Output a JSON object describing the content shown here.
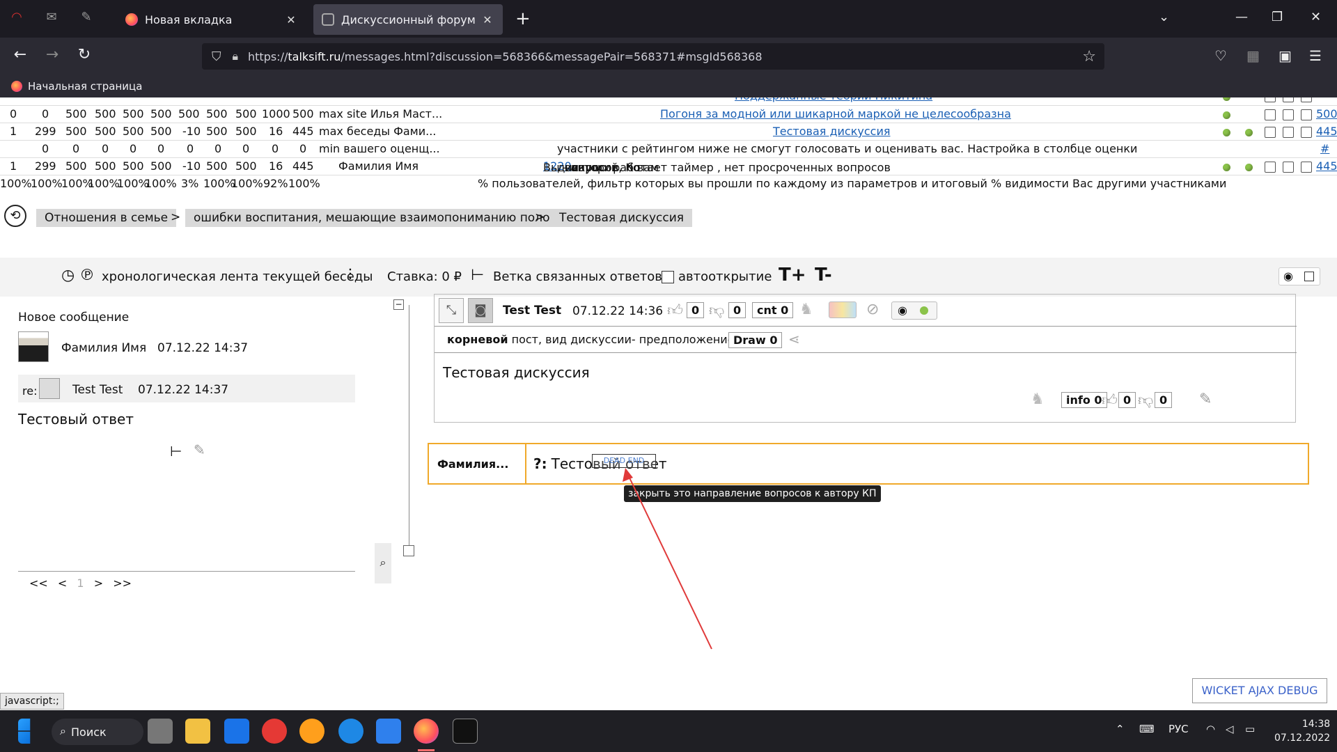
{
  "browser": {
    "tabs": [
      {
        "label": "Новая вкладка",
        "active": false
      },
      {
        "label": "Дискуссионный форум",
        "active": true
      }
    ],
    "url_prefix": "https://",
    "url_host": "talksift.ru",
    "url_path": "/messages.html?discussion=568366&messagePair=568371#msgId568368",
    "bookmark": "Начальная страница"
  },
  "stats": {
    "rows": [
      {
        "cols": [
          "0",
          "0",
          "500",
          "500",
          "500",
          "500",
          "500",
          "500",
          "500",
          "1000",
          "500"
        ],
        "label": "max site Илья Маст...",
        "link": "Погоня за модной или шикарной маркой не целесообразна",
        "right_link": "500"
      },
      {
        "cols": [
          "1",
          "299",
          "500",
          "500",
          "500",
          "500",
          "-10",
          "500",
          "500",
          "16",
          "445"
        ],
        "label": "max беседы Фами...",
        "link": "Тестовая дискуссия",
        "right_link": "445"
      },
      {
        "cols": [
          "",
          "0",
          "0",
          "0",
          "0",
          "0",
          "0",
          "0",
          "0",
          "0",
          "0"
        ],
        "label": "min вашего оценщ...",
        "note": "участники с рейтингом ниже не смогут голосовать и оценивать вас. Настройка в столбце оценки",
        "right_link": "#"
      },
      {
        "cols": [
          "1",
          "299",
          "500",
          "500",
          "500",
          "500",
          "-10",
          "500",
          "500",
          "16",
          "445"
        ],
        "label": "Фамилия Имя",
        "note_pre": "Вы - автор ",
        "n1": "12",
        "note_mid1": " дискуссий. К вам ",
        "n2": "2",
        "note_mid2": " вопросов, по ",
        "n3": "0",
        "note_post": " из них работает таймер , нет просроченных вопросов",
        "right_link": "445"
      },
      {
        "cols": [
          "100%",
          "100%",
          "100%",
          "100%",
          "100%",
          "100%",
          "3%",
          "100%",
          "100%",
          "92%",
          "100%"
        ],
        "note": "% пользователей, фильтр которых вы прошли по каждому из параметров и итоговый % видимости Вас другими участниками"
      }
    ]
  },
  "breadcrumbs": [
    "Отношения в семье",
    "ошибки воспитания, мешающие взаимопониманию полов",
    "Тестовая дискуссия"
  ],
  "toolbar": {
    "timeline": "хронологическая лента текущей беседы",
    "stake": "Ставка: 0 ₽",
    "branch": "Ветка связанных ответов",
    "autoopen": "автооткрытие",
    "font_up": "T+",
    "font_down": "T-"
  },
  "left": {
    "title": "Новое сообщение",
    "author": "Фамилия Имя",
    "author_date": "07.12.22 14:37",
    "re": "re:",
    "re_author": "Test Test",
    "re_date": "07.12.22 14:37",
    "body": "Тестовый ответ",
    "pager": [
      "<<",
      "<",
      "1",
      ">",
      ">>"
    ]
  },
  "post": {
    "author": "Test Test",
    "date": "07.12.22 14:36",
    "likes": "0",
    "dislikes": "0",
    "cnt": "cnt 0",
    "root": "корневой",
    "kind": " пост, вид дискуссии- предположение",
    "draw": "Draw 0",
    "content": "Тестовая дискуссия",
    "info": "info 0",
    "foot_likes": "0",
    "foot_dislikes": "0"
  },
  "question": {
    "name": "Фамилия...",
    "prefix": "?:",
    "text": "Тестовый ответ",
    "dead_end": "DEAD END",
    "tooltip": "закрыть это направление вопросов к автору КП"
  },
  "debug": "WICKET AJAX DEBUG",
  "status": "javascript:;",
  "taskbar": {
    "search": "Поиск",
    "lang": "РУС",
    "time": "14:38",
    "date": "07.12.2022"
  },
  "colors": {
    "accent_orange": "#f0a92a",
    "link": "#1a5fb4",
    "dot_green": "#8bc34a",
    "arrow_red": "#e03a3a"
  }
}
